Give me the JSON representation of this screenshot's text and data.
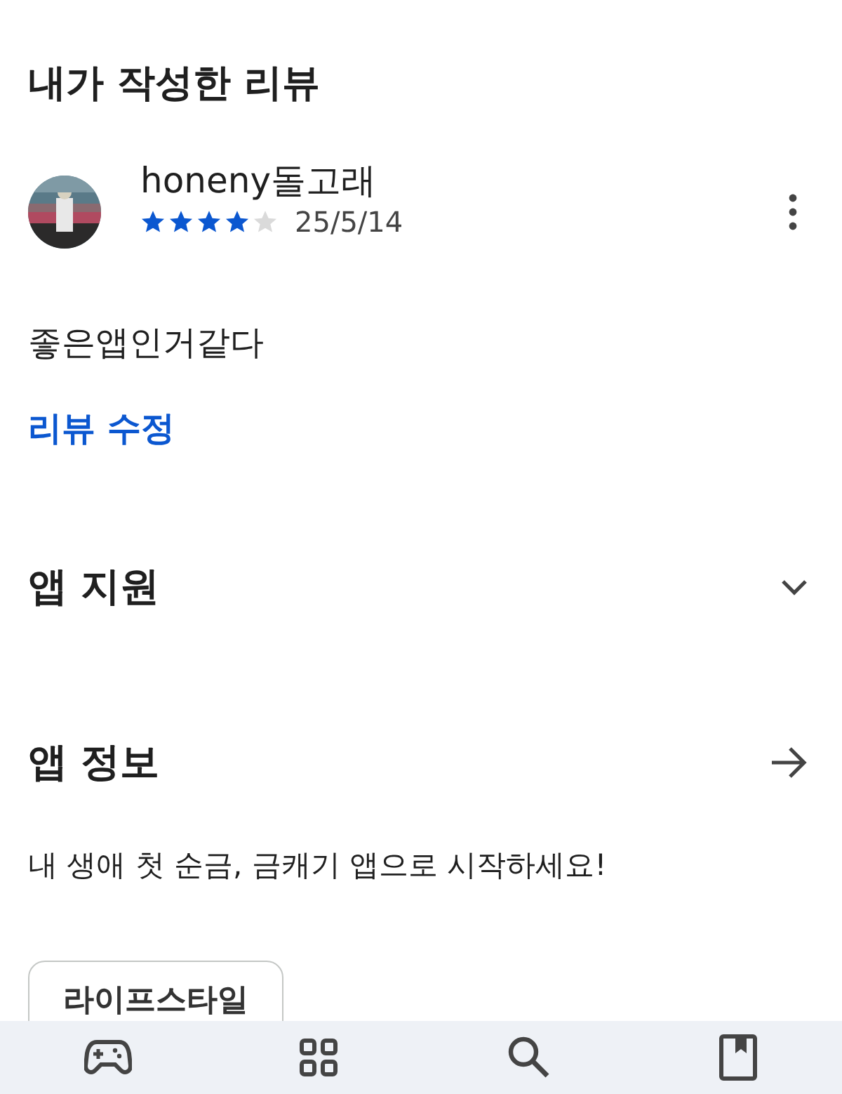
{
  "title": "내가 작성한 리뷰",
  "review": {
    "author": "honeny돌고래",
    "stars": 4,
    "date": "25/5/14",
    "text": "좋은앱인거같다",
    "edit_link": "리뷰 수정"
  },
  "sections": [
    {
      "kind": "expand",
      "title": "앱 지원",
      "expanded": false
    },
    {
      "kind": "link",
      "title": "앱 정보",
      "description": "내 생애 첫 순금, 금캐기 앱으로 시작하세요!"
    }
  ],
  "chips": [
    "라이프스타일"
  ],
  "nav": [
    {
      "kind": "games"
    },
    {
      "kind": "apps"
    },
    {
      "kind": "search"
    },
    {
      "kind": "books"
    }
  ]
}
